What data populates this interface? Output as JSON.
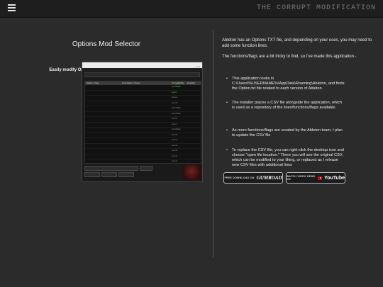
{
  "header": {
    "brand": "THE CORRUPT MODIFICATION"
  },
  "left": {
    "title": "Options Mod Selector",
    "subtitle": "Easily modify Options.txt for all versions of Ableton Live",
    "app_window": {
      "grid_headers": [
        "Option / Flag",
        "Description / Notes",
        "Compatibility",
        "Enabled"
      ],
      "rows": [
        {
          "c1": "",
          "c2": "",
          "c3": "Live 9 Beta",
          "c4": "",
          "green": true
        },
        {
          "c1": "",
          "c2": "",
          "c3": "Live 9",
          "c4": "",
          "green": true
        },
        {
          "c1": "",
          "c2": "",
          "c3": "Live 11",
          "c4": "",
          "green": true
        },
        {
          "c1": "",
          "c2": "",
          "c3": "Live 10",
          "c4": "",
          "green": false
        },
        {
          "c1": "",
          "c2": "",
          "c3": "Live 9 Beta",
          "c4": "",
          "green": false
        },
        {
          "c1": "",
          "c2": "",
          "c3": "Live 9 Beta",
          "c4": "",
          "green": false
        },
        {
          "c1": "",
          "c2": "",
          "c3": "Live 10",
          "c4": "",
          "green": false
        },
        {
          "c1": "",
          "c2": "",
          "c3": "Live 9",
          "c4": "",
          "green": false
        },
        {
          "c1": "",
          "c2": "",
          "c3": "Live 9 Beta",
          "c4": "",
          "green": false
        },
        {
          "c1": "",
          "c2": "",
          "c3": "Live 10",
          "c4": "",
          "green": false
        },
        {
          "c1": "",
          "c2": "",
          "c3": "Live 11",
          "c4": "",
          "green": false
        },
        {
          "c1": "",
          "c2": "",
          "c3": "Live 10",
          "c4": "",
          "green": false
        },
        {
          "c1": "",
          "c2": "",
          "c3": "Live 10",
          "c4": "",
          "green": false
        },
        {
          "c1": "",
          "c2": "",
          "c3": "Live 10",
          "c4": "",
          "green": false
        },
        {
          "c1": "",
          "c2": "",
          "c3": "Live 10",
          "c4": "",
          "green": false
        }
      ]
    }
  },
  "right": {
    "intro": "Ableton has an Options TXT file, and depending on your uses, you may need to add some function lines.",
    "intro2": "The functions/flags are a bit tricky to find, so I've made this application -",
    "bullets": [
      "This application looks in C:\\Users\\%USERNAME%\\AppData\\Roaming\\Ableton, and finds the Option.txt file related to each version of Ableton.",
      "The installer places a CSV file alongside the application, which is used as a repository of the lines/functions/flags available.",
      "As more functions/flags are created by the Ableton team, I plan to update the CSV file",
      "To replace the CSV file, you can right-click the desktop icon and choose \"open file location.\" There you will see the original CSV, which can be modified to your liking, or replaced as I release new CSV files with additional lines"
    ],
    "download_small": "FREE DOWNLOAD ON",
    "download_big": "GUMROAD",
    "video_small": "WATCH VIDEO DEMO ON",
    "video_big": "YouTube"
  },
  "colors": {
    "background": "#2b2b2b",
    "green_rows": "#5fcf6a",
    "youtube_red": "#e00000"
  }
}
